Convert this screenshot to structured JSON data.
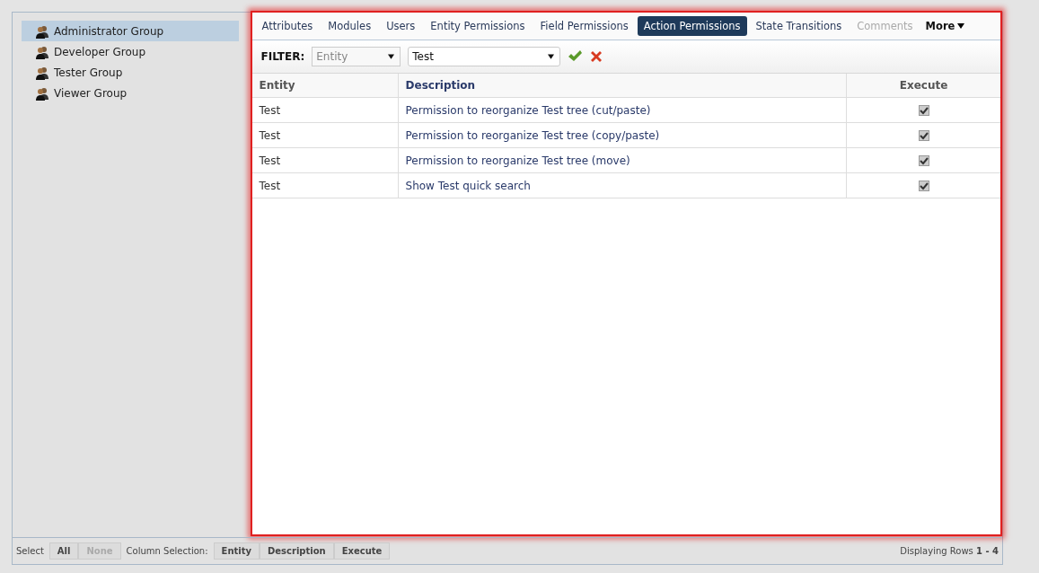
{
  "groups": [
    {
      "label": "Administrator Group",
      "selected": true
    },
    {
      "label": "Developer Group",
      "selected": false
    },
    {
      "label": "Tester Group",
      "selected": false
    },
    {
      "label": "Viewer Group",
      "selected": false
    }
  ],
  "tabs": [
    {
      "label": "Attributes",
      "selected": false,
      "disabled": false
    },
    {
      "label": "Modules",
      "selected": false,
      "disabled": false
    },
    {
      "label": "Users",
      "selected": false,
      "disabled": false
    },
    {
      "label": "Entity Permissions",
      "selected": false,
      "disabled": false
    },
    {
      "label": "Field Permissions",
      "selected": false,
      "disabled": false
    },
    {
      "label": "Action Permissions",
      "selected": true,
      "disabled": false
    },
    {
      "label": "State Transitions",
      "selected": false,
      "disabled": false
    },
    {
      "label": "Comments",
      "selected": false,
      "disabled": true
    }
  ],
  "more_menu": "More",
  "filter": {
    "label": "FILTER:",
    "field_placeholder": "Entity",
    "value": "Test"
  },
  "table": {
    "columns": [
      "Entity",
      "Description",
      "Execute"
    ],
    "rows": [
      {
        "entity": "Test",
        "description": "Permission to reorganize Test tree (cut/paste)",
        "execute": true
      },
      {
        "entity": "Test",
        "description": "Permission to reorganize Test tree (copy/paste)",
        "execute": true
      },
      {
        "entity": "Test",
        "description": "Permission to reorganize Test tree (move)",
        "execute": true
      },
      {
        "entity": "Test",
        "description": "Show Test quick search",
        "execute": true
      }
    ]
  },
  "footer": {
    "select_label": "Select",
    "select_buttons": [
      {
        "label": "All",
        "disabled": false
      },
      {
        "label": "None",
        "disabled": true
      }
    ],
    "column_selection_label": "Column Selection:",
    "column_buttons": [
      "Entity",
      "Description",
      "Execute"
    ],
    "row_info": "Displaying Rows **1 - 4**"
  }
}
